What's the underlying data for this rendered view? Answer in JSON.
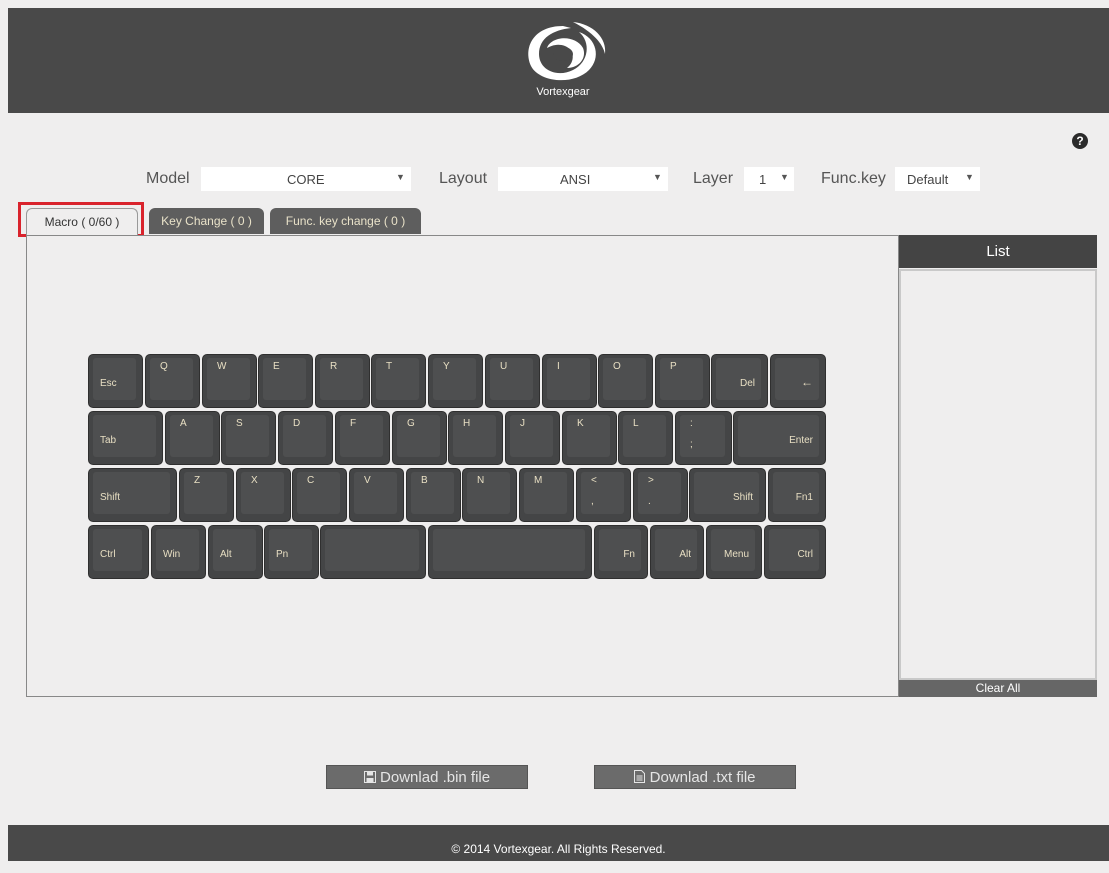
{
  "brand": {
    "name": "Vortexgear"
  },
  "controls": {
    "model": {
      "label": "Model",
      "value": "CORE"
    },
    "layout": {
      "label": "Layout",
      "value": "ANSI"
    },
    "layer": {
      "label": "Layer",
      "value": "1"
    },
    "funckey": {
      "label": "Func.key",
      "value": "Default"
    }
  },
  "tabs": [
    {
      "label": "Macro ( 0/60 )"
    },
    {
      "label": "Key Change ( 0 )"
    },
    {
      "label": "Func. key change ( 0 )"
    }
  ],
  "keyboard": {
    "rows": [
      [
        {
          "t": "Esc"
        },
        {
          "t": "Q"
        },
        {
          "t": "W"
        },
        {
          "t": "E"
        },
        {
          "t": "R"
        },
        {
          "t": "T"
        },
        {
          "t": "Y"
        },
        {
          "t": "U"
        },
        {
          "t": "I"
        },
        {
          "t": "O"
        },
        {
          "t": "P"
        },
        {
          "t": "Del"
        },
        {
          "t": "←"
        }
      ],
      [
        {
          "t": "Tab"
        },
        {
          "t": "A"
        },
        {
          "t": "S"
        },
        {
          "t": "D"
        },
        {
          "t": "F"
        },
        {
          "t": "G"
        },
        {
          "t": "H"
        },
        {
          "t": "J"
        },
        {
          "t": "K"
        },
        {
          "t": "L"
        },
        {
          "t": ":",
          "b": ";"
        },
        {
          "t": "Enter"
        }
      ],
      [
        {
          "t": "Shift"
        },
        {
          "t": "Z"
        },
        {
          "t": "X"
        },
        {
          "t": "C"
        },
        {
          "t": "V"
        },
        {
          "t": "B"
        },
        {
          "t": "N"
        },
        {
          "t": "M"
        },
        {
          "t": "<",
          "b": ","
        },
        {
          "t": ">",
          "b": "."
        },
        {
          "t": "Shift"
        },
        {
          "t": "Fn1"
        }
      ],
      [
        {
          "t": "Ctrl"
        },
        {
          "t": "Win"
        },
        {
          "t": "Alt"
        },
        {
          "t": "Pn"
        },
        {
          "t": ""
        },
        {
          "t": ""
        },
        {
          "t": "Fn"
        },
        {
          "t": "Alt"
        },
        {
          "t": "Menu"
        },
        {
          "t": "Ctrl"
        }
      ]
    ]
  },
  "sidebar": {
    "title": "List",
    "clear_label": "Clear All"
  },
  "downloads": {
    "bin_label": "Downlad .bin file",
    "txt_label": "Downlad .txt file"
  },
  "footer": {
    "text": "© 2014 Vortexgear. All Rights Reserved."
  },
  "icons": {
    "help": "question-circle-icon",
    "bin": "floppy-disk-icon",
    "txt": "file-text-icon",
    "logo": "vortex-swirl-logo"
  }
}
